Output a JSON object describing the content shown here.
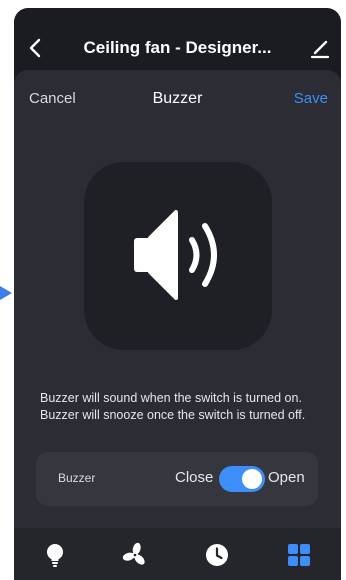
{
  "header": {
    "title": "Ceiling fan - Designer..."
  },
  "sheet": {
    "cancel_label": "Cancel",
    "title": "Buzzer",
    "save_label": "Save"
  },
  "description": "Buzzer will sound when the switch is turned on. Buzzer will snooze once the switch is turned off.",
  "setting": {
    "label": "Buzzer",
    "off_label": "Close",
    "on_label": "Open",
    "enabled": true
  },
  "tabbar": {
    "icons": [
      "lightbulb-icon",
      "fan-icon",
      "clock-icon",
      "grid-icon"
    ]
  },
  "colors": {
    "accent": "#3d8ef8",
    "background": "#1b1c22",
    "sheet": "#2c2d34"
  }
}
